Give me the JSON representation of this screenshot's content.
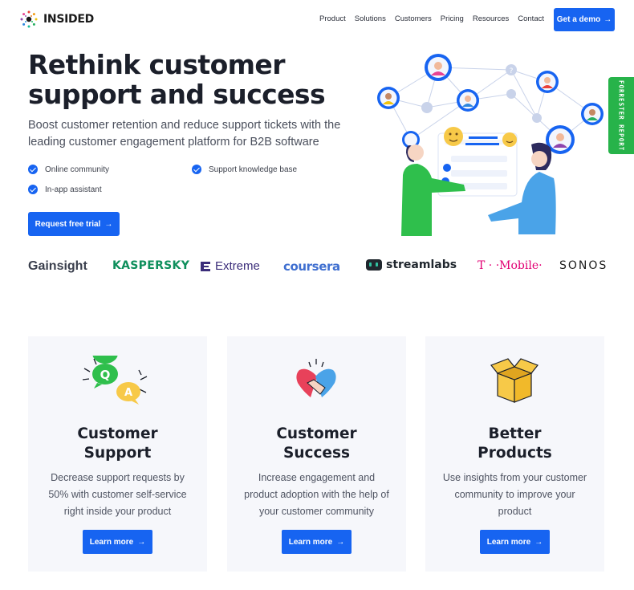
{
  "nav": {
    "logo_text": "INSIDED",
    "links": [
      "Product",
      "Solutions",
      "Customers",
      "Pricing",
      "Resources",
      "Contact"
    ],
    "cta": "Get a demo",
    "arrow": "→"
  },
  "hero": {
    "title": "Rethink customer support and success",
    "subtitle": "Boost customer retention and reduce support tickets with the leading customer engagement platform for B2B software",
    "features": [
      "Online community",
      "Support knowledge base",
      "In-app assistant"
    ],
    "cta": "Request free trial",
    "side_tab": "FORRESTER REPORT"
  },
  "logos": [
    "Gainsight",
    "KASPERSKY",
    "Extreme",
    "coursera",
    "streamlabs",
    "T · ·Mobile·",
    "SONOS"
  ],
  "cards": [
    {
      "title": "Customer\nSupport",
      "desc": "Decrease support requests by 50% with customer self-service right inside your product",
      "cta": "Learn more",
      "icon_q": "Q",
      "icon_a": "A"
    },
    {
      "title": "Customer\nSuccess",
      "desc": "Increase engagement and product adoption with the help of your customer community",
      "cta": "Learn more"
    },
    {
      "title": "Better\nProducts",
      "desc": "Use insights from your customer community to improve your product",
      "cta": "Learn more"
    }
  ],
  "colors": {
    "primary": "#1764f1",
    "forrester": "#27b34a",
    "card_bg": "#f6f7fb"
  }
}
